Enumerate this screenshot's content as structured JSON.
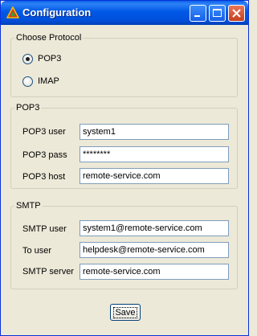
{
  "window": {
    "title": "Configuration",
    "icon": "triangle-icon",
    "controls": [
      "minimize-icon",
      "maximize-icon",
      "close-icon"
    ]
  },
  "protocol": {
    "legend": "Choose Protocol",
    "options": [
      {
        "label": "POP3",
        "selected": true
      },
      {
        "label": "IMAP",
        "selected": false
      }
    ]
  },
  "pop3": {
    "legend": "POP3",
    "user_label": "POP3 user",
    "user_value": "system1",
    "pass_label": "POP3 pass",
    "pass_value": "********",
    "host_label": "POP3 host",
    "host_value": "remote-service.com"
  },
  "smtp": {
    "legend": "SMTP",
    "user_label": "SMTP user",
    "user_value": "system1@remote-service.com",
    "to_label": "To user",
    "to_value": "helpdesk@remote-service.com",
    "server_label": "SMTP server",
    "server_value": "remote-service.com"
  },
  "save_label": "Save",
  "colors": {
    "titlebar": "#0058e6",
    "close_button": "#c4401e",
    "window_bg": "#ece9d8"
  }
}
